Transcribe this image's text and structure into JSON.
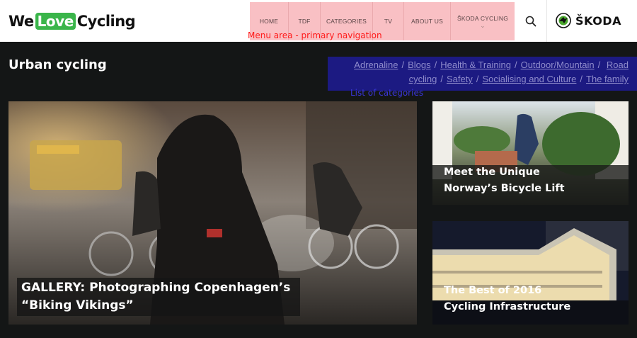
{
  "brand": {
    "logo_prefix": "We",
    "logo_love": "Love",
    "logo_suffix": "Cycling",
    "sponsor": "ŠKODA"
  },
  "nav": {
    "items": [
      "HOME",
      "TDF",
      "CATEGORIES",
      "TV",
      "ABOUT US",
      "ŠKODA CYCLING"
    ],
    "overlay_label": "Menu area - primary navigation"
  },
  "search": {
    "icon": "search-icon"
  },
  "page": {
    "title": "Urban cycling"
  },
  "categories": {
    "items": [
      "Adrenaline",
      "Blogs",
      "Health & Training",
      "Outdoor/Mountain",
      "Road cycling",
      "Safety",
      "Socialising and Culture",
      "The family"
    ],
    "overlay_label": "List of categories"
  },
  "articles": [
    {
      "title": "GALLERY: Photographing Copenhagen’s “Biking Vikings”"
    },
    {
      "title_line1": "Meet the Unique",
      "title_line2": "Norway’s Bicycle Lift"
    },
    {
      "title_line1": "The Best of 2016",
      "title_line2": "Cycling Infrastructure"
    }
  ],
  "colors": {
    "accent_green": "#3ab54a",
    "nav_overlay": "#f9c0c4",
    "category_overlay": "#1c1a82",
    "page_bg": "#141616"
  }
}
